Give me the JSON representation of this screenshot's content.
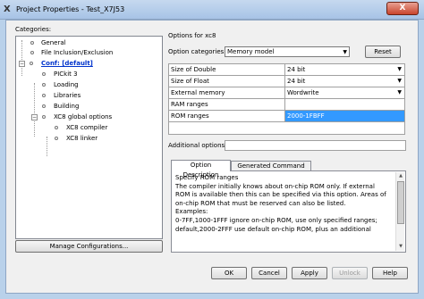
{
  "window": {
    "title": "Project Properties - Test_X7J53",
    "app_icon": "x-logo-icon",
    "close_glyph": "X"
  },
  "categories": {
    "label": "Categories:",
    "items": [
      {
        "label": "General"
      },
      {
        "label": "File Inclusion/Exclusion"
      },
      {
        "label": "Conf: [default]"
      },
      {
        "label": "PICkit 3"
      },
      {
        "label": "Loading"
      },
      {
        "label": "Libraries"
      },
      {
        "label": "Building"
      },
      {
        "label": "XC8 global options"
      },
      {
        "label": "XC8 compiler"
      },
      {
        "label": "XC8 linker"
      }
    ],
    "expander_glyph": "−"
  },
  "options": {
    "header": "Options for xc8",
    "categories_label": "Option categories:",
    "categories_value": "Memory model",
    "reset_label": "Reset",
    "arrow": "▼",
    "rows": [
      {
        "key": "Size of Double",
        "value": "24 bit",
        "dropdown": true
      },
      {
        "key": "Size of Float",
        "value": "24 bit",
        "dropdown": true
      },
      {
        "key": "External memory",
        "value": "Wordwrite",
        "dropdown": true
      },
      {
        "key": "RAM ranges",
        "value": ""
      },
      {
        "key": "ROM ranges",
        "value": "2000-1FBFF",
        "selected": true
      }
    ],
    "additional_label": "Additional options:",
    "additional_value": ""
  },
  "tabs": [
    {
      "label": "Option Description",
      "active": true
    },
    {
      "label": "Generated Command Line",
      "active": false
    }
  ],
  "description": {
    "lines": [
      "Specify ROM ranges",
      "The compiler initially knows about on-chip ROM only. If external",
      "ROM is available then this can be specified via this option. Areas of",
      "on-chip ROM that must be reserved can also be listed.",
      "Examples:",
      "0-7FF,1000-1FFF ignore on-chip ROM, use only specified ranges;",
      "default,2000-2FFF use default on-chip ROM, plus an additional"
    ]
  },
  "buttons": {
    "manage": "Manage Configurations...",
    "ok": "OK",
    "cancel": "Cancel",
    "apply": "Apply",
    "unlock": "Unlock",
    "help": "Help"
  },
  "colors": {
    "selection": "#3399ff",
    "link": "#0033cc",
    "title_bar": "#b9d1ea"
  }
}
